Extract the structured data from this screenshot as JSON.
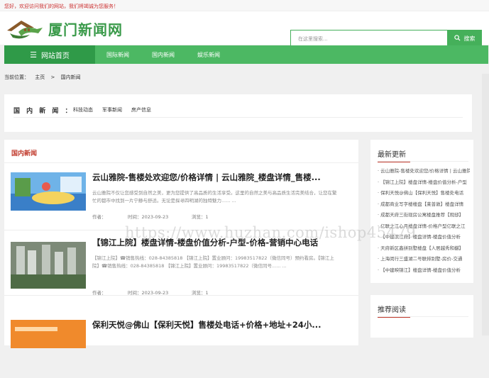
{
  "topbar": {
    "text": "您好，欢迎访问我们的网站，我们将竭诚为您服务！"
  },
  "logo": {
    "text": "厦门新闻网",
    "icon": "house-roof-logo",
    "accent": "#3a9a4a"
  },
  "search": {
    "placeholder": "在这里搜索...",
    "button_label": "搜索",
    "icon": "search-icon"
  },
  "nav": {
    "items": [
      {
        "label": "网站首页",
        "icon": "menu-icon"
      },
      {
        "label": "国际新闻"
      },
      {
        "label": "国内新闻"
      },
      {
        "label": "娱乐新闻"
      }
    ]
  },
  "breadcrumb": {
    "prefix": "当前位置：",
    "home": "主页",
    "sep": ">",
    "current": "国内新闻"
  },
  "category": {
    "title": "国 内 新 闻 ：",
    "links": [
      "科技动态",
      "军事新闻",
      "房产信息"
    ]
  },
  "main": {
    "title": "国内新闻",
    "articles": [
      {
        "title": "云山雅院-售楼处欢迎您/价格详情 | 云山雅院_楼盘详情_售楼...",
        "desc": "云山雅院不仅让您感受到自然之美，更为您提供了高品质的生活享受。这里的自然之美与高品质生活完美结合，让您在繁忙的都市中找到一片宁静与舒适。无论是探寻四明湖的独特魅力...... ...",
        "author": "作者：",
        "time": "时间：2023-09-23",
        "views": "浏览：1"
      },
      {
        "title": "【锦江上院】楼盘详情-楼盘价值分析-户型-价格-营销中心电话",
        "desc": "【锦江上院】☎销售热线：028-84385818 【锦江上院】置业顾问：19983517822（微信同号）预约看房。【锦江上院】☎销售热线：028-84385818 【锦江上院】置业顾问：19983517822（微信同号...... ...",
        "author": "作者：",
        "time": "时间：2023-09-23",
        "views": "浏览：1"
      },
      {
        "title": "保利天悦@佛山【保利天悦】售楼处电话+价格+地址+24小...",
        "desc": "",
        "author": "",
        "time": "",
        "views": ""
      }
    ]
  },
  "sidebar": {
    "latest_title": "最新更新",
    "latest": [
      "云山雅院-售楼处欢迎您/价格详情 | 云山雅院",
      "【锦江上院】楼盘详情-楼盘价值分析-户型",
      "保利天悦@佛山【保利天悦】售楼处电话",
      "成都商业写字楼楼盘【莱普敦】楼盘详情",
      "成都天府三街现房公寓楼盘推荐【观邸】",
      "亿联之江心月楼盘详情-价格户型亿联之江",
      "【中建滨江府】楼盘详情-楼盘价值分析",
      "天府新区鑫拼别墅楼盘【人居越秀和樾】",
      "上海闵行三盛湖二号联排别墅-房价-交通",
      "【中建映锦江】楼盘详情-楼盘价值分析"
    ],
    "recommend_title": "推荐阅读"
  },
  "watermark": {
    "text": "https://www.huzhan.com/ishop45479"
  },
  "colors": {
    "green": "#4cb863",
    "dark_green": "#2f9a48",
    "red": "#c0392b"
  }
}
